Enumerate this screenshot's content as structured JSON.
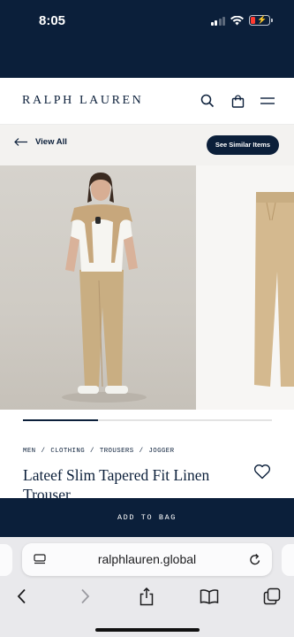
{
  "status_bar": {
    "time": "8:05",
    "background": "#0b1f3a",
    "icons": [
      "cellular-signal-icon",
      "wifi-icon",
      "battery-low-charging-icon"
    ],
    "battery_color": "#ff3b30"
  },
  "header": {
    "logo": "RALPH LAUREN",
    "icons": [
      "search-icon",
      "shopping-bag-icon",
      "menu-icon"
    ]
  },
  "nav": {
    "back_label": "View All",
    "similar_label": "See Similar Items"
  },
  "gallery": {
    "progress": 0.3,
    "images": [
      "model-photo",
      "product-flat-photo"
    ]
  },
  "product": {
    "breadcrumb": [
      "MEN",
      "CLOTHING",
      "TROUSERS",
      "JOGGER"
    ],
    "breadcrumb_separator": "/",
    "title": "Lateef Slim Tapered Fit Linen Trouser"
  },
  "cta": {
    "add_to_bag": "ADD TO BAG"
  },
  "browser": {
    "url": "ralphlauren.global",
    "toolbar_icons": [
      "back-icon",
      "forward-icon",
      "share-icon",
      "bookmarks-icon",
      "tabs-icon"
    ]
  },
  "colors": {
    "navy": "#0b1f3a",
    "nav_bg": "#f3f2f0",
    "browser_bg": "#e9e9ec"
  }
}
